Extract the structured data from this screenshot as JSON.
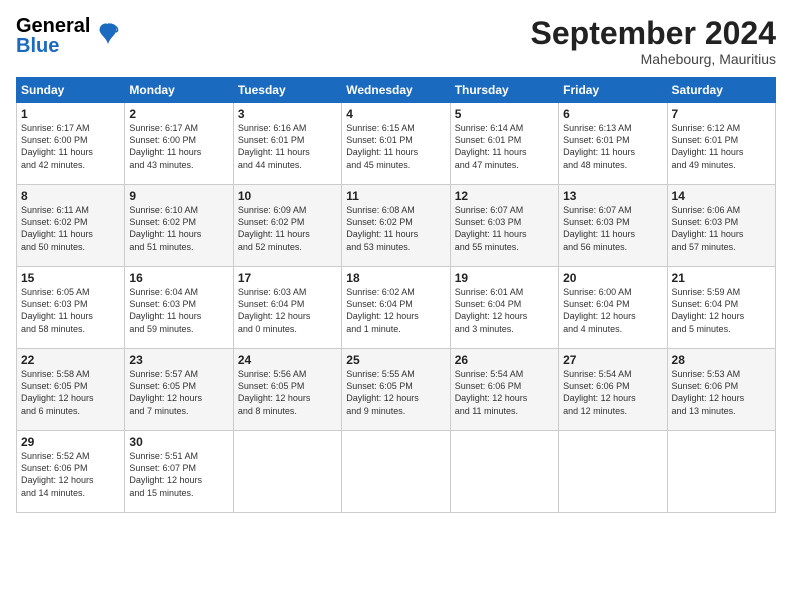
{
  "header": {
    "logo_line1": "General",
    "logo_line2": "Blue",
    "month_title": "September 2024",
    "subtitle": "Mahebourg, Mauritius"
  },
  "weekdays": [
    "Sunday",
    "Monday",
    "Tuesday",
    "Wednesday",
    "Thursday",
    "Friday",
    "Saturday"
  ],
  "weeks": [
    [
      {
        "day": "1",
        "info": "Sunrise: 6:17 AM\nSunset: 6:00 PM\nDaylight: 11 hours\nand 42 minutes."
      },
      {
        "day": "2",
        "info": "Sunrise: 6:17 AM\nSunset: 6:00 PM\nDaylight: 11 hours\nand 43 minutes."
      },
      {
        "day": "3",
        "info": "Sunrise: 6:16 AM\nSunset: 6:01 PM\nDaylight: 11 hours\nand 44 minutes."
      },
      {
        "day": "4",
        "info": "Sunrise: 6:15 AM\nSunset: 6:01 PM\nDaylight: 11 hours\nand 45 minutes."
      },
      {
        "day": "5",
        "info": "Sunrise: 6:14 AM\nSunset: 6:01 PM\nDaylight: 11 hours\nand 47 minutes."
      },
      {
        "day": "6",
        "info": "Sunrise: 6:13 AM\nSunset: 6:01 PM\nDaylight: 11 hours\nand 48 minutes."
      },
      {
        "day": "7",
        "info": "Sunrise: 6:12 AM\nSunset: 6:01 PM\nDaylight: 11 hours\nand 49 minutes."
      }
    ],
    [
      {
        "day": "8",
        "info": "Sunrise: 6:11 AM\nSunset: 6:02 PM\nDaylight: 11 hours\nand 50 minutes."
      },
      {
        "day": "9",
        "info": "Sunrise: 6:10 AM\nSunset: 6:02 PM\nDaylight: 11 hours\nand 51 minutes."
      },
      {
        "day": "10",
        "info": "Sunrise: 6:09 AM\nSunset: 6:02 PM\nDaylight: 11 hours\nand 52 minutes."
      },
      {
        "day": "11",
        "info": "Sunrise: 6:08 AM\nSunset: 6:02 PM\nDaylight: 11 hours\nand 53 minutes."
      },
      {
        "day": "12",
        "info": "Sunrise: 6:07 AM\nSunset: 6:03 PM\nDaylight: 11 hours\nand 55 minutes."
      },
      {
        "day": "13",
        "info": "Sunrise: 6:07 AM\nSunset: 6:03 PM\nDaylight: 11 hours\nand 56 minutes."
      },
      {
        "day": "14",
        "info": "Sunrise: 6:06 AM\nSunset: 6:03 PM\nDaylight: 11 hours\nand 57 minutes."
      }
    ],
    [
      {
        "day": "15",
        "info": "Sunrise: 6:05 AM\nSunset: 6:03 PM\nDaylight: 11 hours\nand 58 minutes."
      },
      {
        "day": "16",
        "info": "Sunrise: 6:04 AM\nSunset: 6:03 PM\nDaylight: 11 hours\nand 59 minutes."
      },
      {
        "day": "17",
        "info": "Sunrise: 6:03 AM\nSunset: 6:04 PM\nDaylight: 12 hours\nand 0 minutes."
      },
      {
        "day": "18",
        "info": "Sunrise: 6:02 AM\nSunset: 6:04 PM\nDaylight: 12 hours\nand 1 minute."
      },
      {
        "day": "19",
        "info": "Sunrise: 6:01 AM\nSunset: 6:04 PM\nDaylight: 12 hours\nand 3 minutes."
      },
      {
        "day": "20",
        "info": "Sunrise: 6:00 AM\nSunset: 6:04 PM\nDaylight: 12 hours\nand 4 minutes."
      },
      {
        "day": "21",
        "info": "Sunrise: 5:59 AM\nSunset: 6:04 PM\nDaylight: 12 hours\nand 5 minutes."
      }
    ],
    [
      {
        "day": "22",
        "info": "Sunrise: 5:58 AM\nSunset: 6:05 PM\nDaylight: 12 hours\nand 6 minutes."
      },
      {
        "day": "23",
        "info": "Sunrise: 5:57 AM\nSunset: 6:05 PM\nDaylight: 12 hours\nand 7 minutes."
      },
      {
        "day": "24",
        "info": "Sunrise: 5:56 AM\nSunset: 6:05 PM\nDaylight: 12 hours\nand 8 minutes."
      },
      {
        "day": "25",
        "info": "Sunrise: 5:55 AM\nSunset: 6:05 PM\nDaylight: 12 hours\nand 9 minutes."
      },
      {
        "day": "26",
        "info": "Sunrise: 5:54 AM\nSunset: 6:06 PM\nDaylight: 12 hours\nand 11 minutes."
      },
      {
        "day": "27",
        "info": "Sunrise: 5:54 AM\nSunset: 6:06 PM\nDaylight: 12 hours\nand 12 minutes."
      },
      {
        "day": "28",
        "info": "Sunrise: 5:53 AM\nSunset: 6:06 PM\nDaylight: 12 hours\nand 13 minutes."
      }
    ],
    [
      {
        "day": "29",
        "info": "Sunrise: 5:52 AM\nSunset: 6:06 PM\nDaylight: 12 hours\nand 14 minutes."
      },
      {
        "day": "30",
        "info": "Sunrise: 5:51 AM\nSunset: 6:07 PM\nDaylight: 12 hours\nand 15 minutes."
      },
      null,
      null,
      null,
      null,
      null
    ]
  ]
}
